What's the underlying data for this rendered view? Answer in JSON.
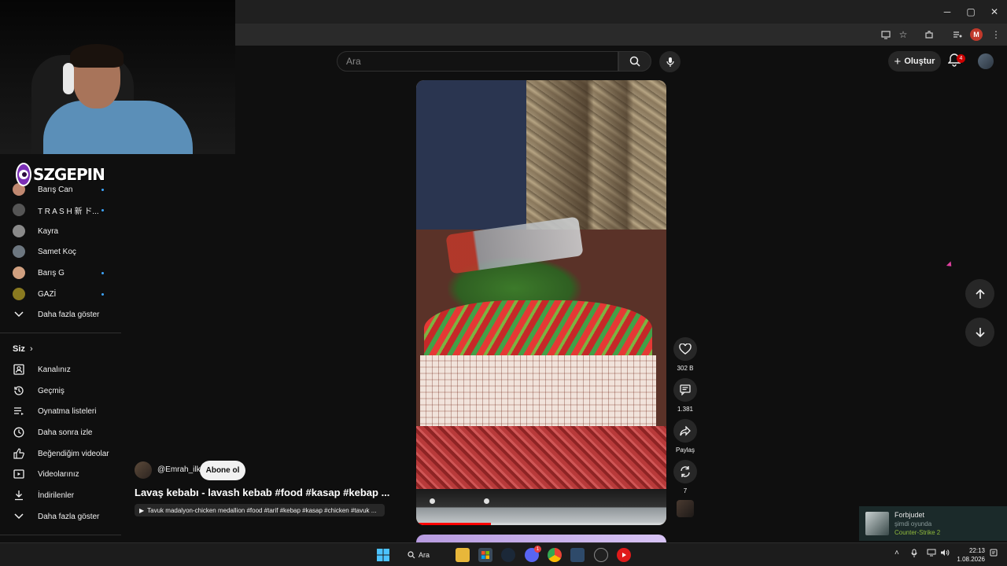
{
  "browser": {
    "window_controls": {
      "minimize": "─",
      "maximize": "▢",
      "close": "✕"
    },
    "profile_initial": "M"
  },
  "webcam": {
    "overlay_logo_text": "SZGEPIN"
  },
  "header": {
    "search_placeholder": "Ara",
    "create_label": "Oluştur",
    "notification_count": "4"
  },
  "sidebar": {
    "subscriptions": [
      {
        "label": "Barış Can",
        "avatar_color": "#c08870",
        "has_dot": true
      },
      {
        "label": "T R A S H 新 ド...",
        "avatar_color": "#555555",
        "has_dot": true
      },
      {
        "label": "Kayra",
        "avatar_color": "#8a8a8a",
        "has_dot": false
      },
      {
        "label": "Samet Koç",
        "avatar_color": "#6d7780",
        "has_dot": false
      },
      {
        "label": "Barış G",
        "avatar_color": "#d0a080",
        "has_dot": true
      },
      {
        "label": "GAZİ",
        "avatar_color": "#8a7a20",
        "has_dot": true
      }
    ],
    "show_more_label": "Daha fazla göster",
    "you_heading": "Siz",
    "you_items": [
      {
        "label": "Kanalınız",
        "icon": "channel-icon"
      },
      {
        "label": "Geçmiş",
        "icon": "history-icon"
      },
      {
        "label": "Oynatma listeleri",
        "icon": "playlist-icon"
      },
      {
        "label": "Daha sonra izle",
        "icon": "watch-later-icon"
      },
      {
        "label": "Beğendiğim videolar",
        "icon": "like-icon"
      },
      {
        "label": "Videolarınız",
        "icon": "video-icon"
      },
      {
        "label": "İndirilenler",
        "icon": "download-icon"
      },
      {
        "label": "Daha fazla göster",
        "icon": "chevron-down-icon"
      }
    ]
  },
  "short": {
    "channel_handle": "@Emrah_ilk",
    "subscribe_label": "Abone ol",
    "title": "Lavaş kebabı - lavash kebab #food #kasap #kebap ...",
    "related_link": "Tavuk madalyon-chicken medallion #food #tarif #kebap #kasap #chicken #tavuk ...",
    "progress": 0.3,
    "actions": {
      "likes": "302 B",
      "comments": "1.381",
      "share_label": "Paylaş",
      "remix_count": "7"
    }
  },
  "toast": {
    "name": "Forbjudet",
    "status": "şimdi oyunda",
    "game": "Counter-Strike 2"
  },
  "taskbar": {
    "search_label": "Ara",
    "time": "22:13",
    "date": "1.08.2026",
    "discord_badge": "1"
  },
  "colors": {
    "accent_red": "#ff0000",
    "link_blue": "#3ea6ff",
    "game_green": "#90ba3c"
  }
}
